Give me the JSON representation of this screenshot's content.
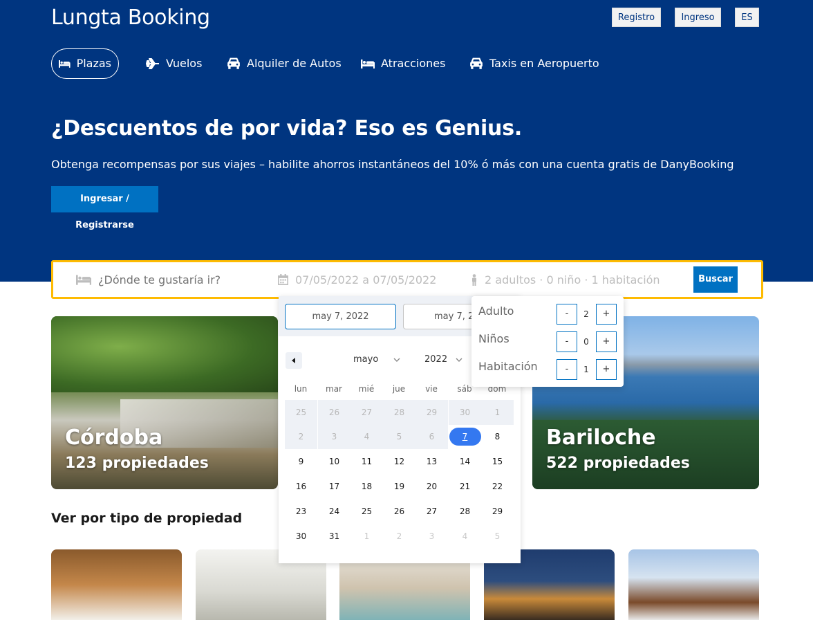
{
  "brand": "Lungta Booking",
  "header": {
    "register": "Registro",
    "login": "Ingreso",
    "lang": "ES"
  },
  "nav": [
    {
      "label": "Plazas",
      "icon": "bed-icon",
      "active": true
    },
    {
      "label": "Vuelos",
      "icon": "plane-icon"
    },
    {
      "label": "Alquiler de Autos",
      "icon": "car-icon"
    },
    {
      "label": "Atracciones",
      "icon": "bed-icon"
    },
    {
      "label": "Taxis en Aeropuerto",
      "icon": "car-icon"
    }
  ],
  "hero": {
    "title": "¿Descuentos de por vida? Eso es Genius.",
    "subtitle": "Obtenga recompensas por sus viajes – habilite ahorros instantáneos del 10% ó más con una cuenta gratis de DanyBooking",
    "button": "Ingresar / Registrarse"
  },
  "search": {
    "destination_placeholder": "¿Dónde te gustaría ir?",
    "dates": "07/05/2022 a 07/05/2022",
    "guests": "2 adultos · 0 niño · 1 habitación",
    "button": "Buscar"
  },
  "datepicker": {
    "start": "may 7, 2022",
    "end": "may 7, 2022",
    "month": "mayo",
    "year": "2022",
    "weekdays": [
      "lun",
      "mar",
      "mié",
      "jue",
      "vie",
      "sáb",
      "dom"
    ],
    "weeks": [
      [
        "25",
        "26",
        "27",
        "28",
        "29",
        "30",
        "1"
      ],
      [
        "2",
        "3",
        "4",
        "5",
        "6",
        "7",
        "8"
      ],
      [
        "9",
        "10",
        "11",
        "12",
        "13",
        "14",
        "15"
      ],
      [
        "16",
        "17",
        "18",
        "19",
        "20",
        "21",
        "22"
      ],
      [
        "23",
        "24",
        "25",
        "26",
        "27",
        "28",
        "29"
      ],
      [
        "30",
        "31",
        "1",
        "2",
        "3",
        "4",
        "5"
      ]
    ],
    "selected_day": "7"
  },
  "guests_popup": {
    "rows": [
      {
        "label": "Adulto",
        "value": "2"
      },
      {
        "label": "Niños",
        "value": "0"
      },
      {
        "label": "Habitación",
        "value": "1"
      }
    ],
    "minus": "-",
    "plus": "+"
  },
  "destinations": [
    {
      "name": "Córdoba",
      "count": "123 propiedades"
    },
    {
      "name": "Bariloche",
      "count": "522 propiedades"
    }
  ],
  "section_title": "Ver por tipo de propiedad",
  "colors": {
    "primary": "#003580",
    "button": "#0071c2",
    "highlight": "#febb02",
    "selected": "#3478f0"
  }
}
